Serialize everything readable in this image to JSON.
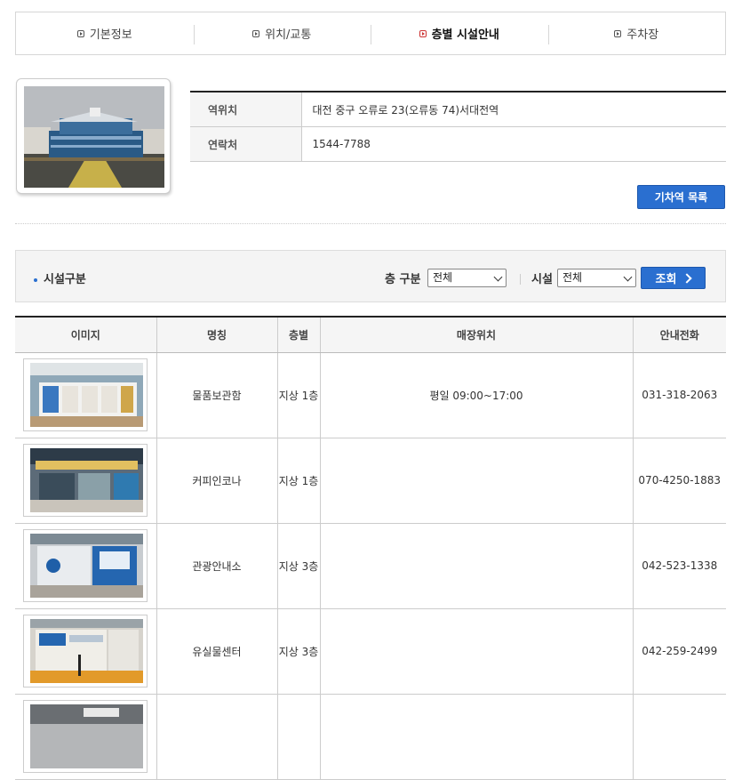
{
  "tabs": [
    {
      "label": "기본정보",
      "active": false
    },
    {
      "label": "위치/교통",
      "active": false
    },
    {
      "label": "층별 시설안내",
      "active": true
    },
    {
      "label": "주차장",
      "active": false
    }
  ],
  "station_info": {
    "rows": [
      {
        "label": "역위치",
        "value": "대전 중구 오류로 23(오류동 74)서대전역"
      },
      {
        "label": "연락처",
        "value": "1544-7788"
      }
    ],
    "list_button": "기차역 목록"
  },
  "filter": {
    "title": "시설구분",
    "floor_label": "층 구분",
    "floor_value": "전체",
    "facility_label": "시설",
    "facility_value": "전체",
    "search_button": "조회"
  },
  "facility_table": {
    "headers": [
      "이미지",
      "명칭",
      "층별",
      "매장위치",
      "안내전화"
    ],
    "rows": [
      {
        "name": "물품보관함",
        "floor": "지상 1층",
        "location": "평일 09:00~17:00",
        "phone": "031-318-2063"
      },
      {
        "name": "커피인코나",
        "floor": "지상 1층",
        "location": "",
        "phone": "070-4250-1883"
      },
      {
        "name": "관광안내소",
        "floor": "지상 3층",
        "location": "",
        "phone": "042-523-1338"
      },
      {
        "name": "유실물센터",
        "floor": "지상 3층",
        "location": "",
        "phone": "042-259-2499"
      },
      {
        "name": "",
        "floor": "",
        "location": "",
        "phone": ""
      }
    ]
  },
  "colors": {
    "accent": "#2a6fd0",
    "active_tab_icon": "#cc3333"
  },
  "icons": [
    "tab-bullet-icon",
    "chevron-down-icon",
    "chevron-right-icon"
  ]
}
